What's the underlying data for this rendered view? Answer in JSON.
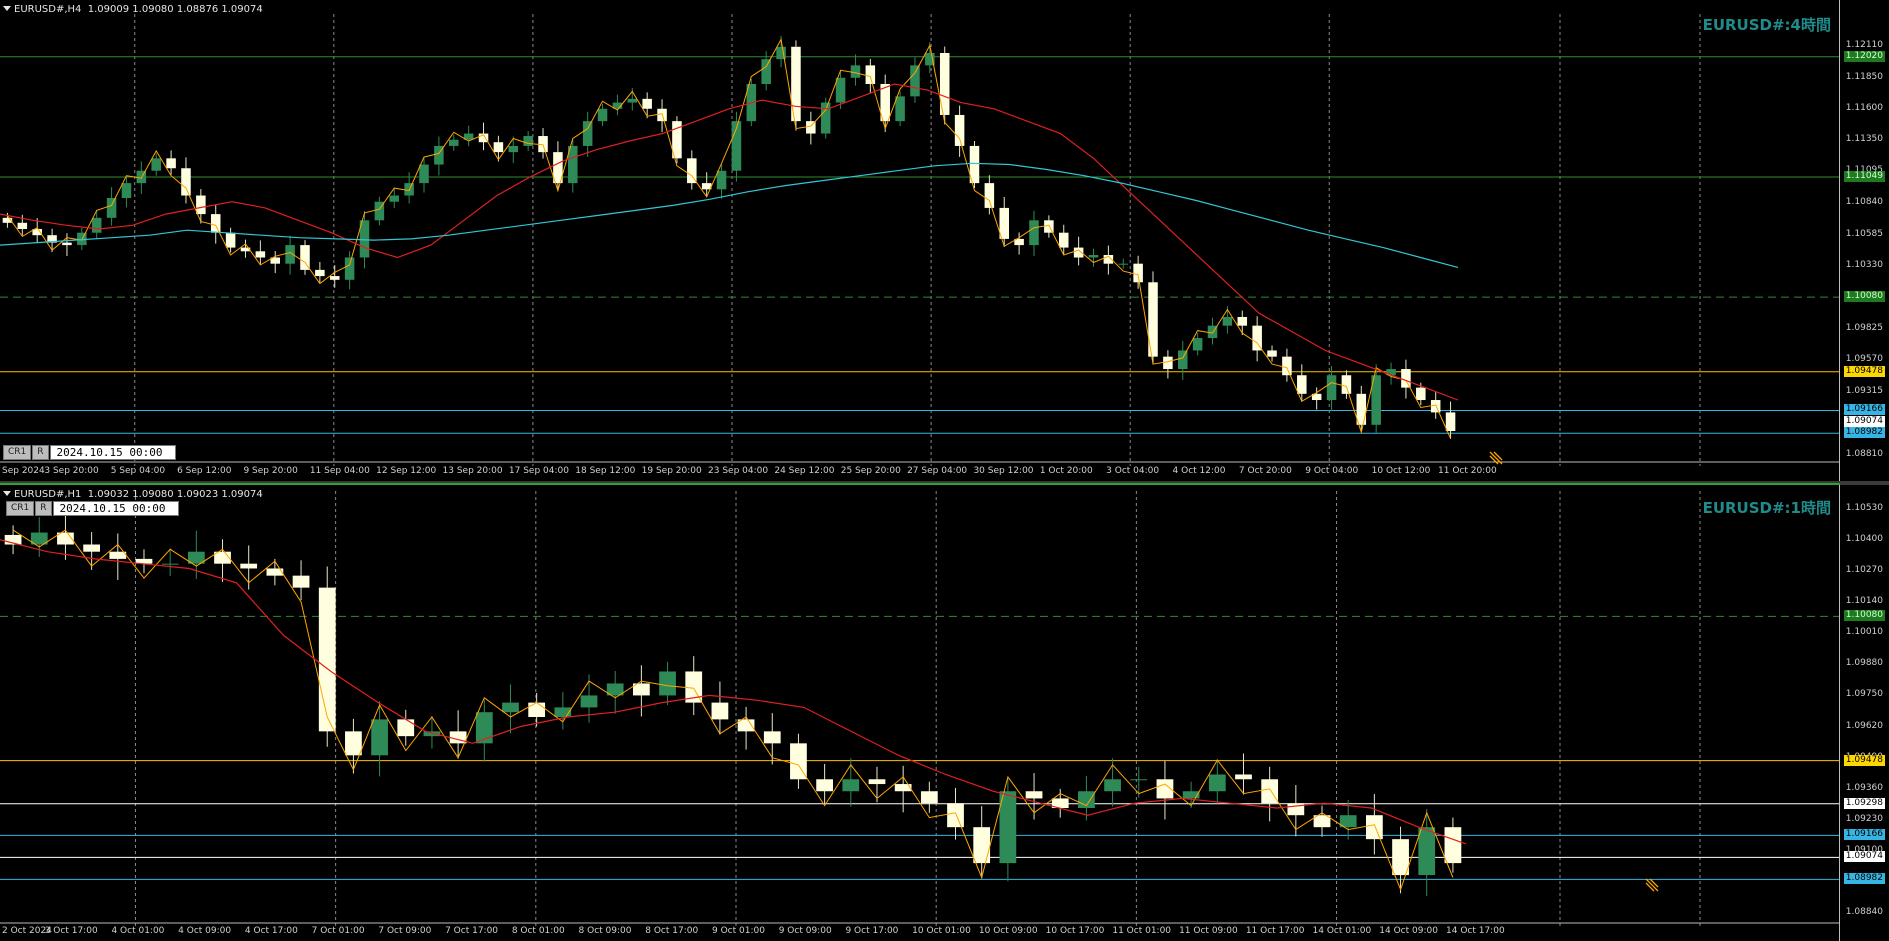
{
  "h4": {
    "header_symbol": "EURUSD#,H4",
    "header_ohlc": "1.09009 1.09080 1.08876 1.09074",
    "title": "EURUSD#:4時間",
    "cr_label": "CR1",
    "r_label": "R",
    "datetime": "2024.10.15 00:00",
    "y_min": 1.0875,
    "y_max": 1.123,
    "y_ticks": [
      "1.12110",
      "1.11850",
      "1.11600",
      "1.11350",
      "1.11095",
      "1.10840",
      "1.10585",
      "1.10330",
      "1.10080",
      "1.09825",
      "1.09570",
      "1.09315",
      "1.09074",
      "1.08810"
    ],
    "x_labels": [
      "Sep 2024",
      "3 Sep 20:00",
      "5 Sep 04:00",
      "6 Sep 12:00",
      "9 Sep 20:00",
      "11 Sep 04:00",
      "12 Sep 12:00",
      "13 Sep 20:00",
      "17 Sep 04:00",
      "18 Sep 12:00",
      "19 Sep 20:00",
      "23 Sep 04:00",
      "24 Sep 12:00",
      "25 Sep 20:00",
      "27 Sep 04:00",
      "30 Sep 12:00",
      "1 Oct 20:00",
      "3 Oct 04:00",
      "4 Oct 12:00",
      "7 Oct 20:00",
      "9 Oct 04:00",
      "10 Oct 12:00",
      "11 Oct 20:00"
    ],
    "levels": [
      {
        "price": 1.1202,
        "label": "1.12020",
        "color": "#2e8b2e",
        "tag_bg": "#1e7a1e",
        "tag_fg": "#d0ffd0",
        "dashed": false
      },
      {
        "price": 1.11049,
        "label": "1.11049",
        "color": "#2e8b2e",
        "tag_bg": "#1e7a1e",
        "tag_fg": "#d0ffd0",
        "dashed": false
      },
      {
        "price": 1.1008,
        "label": "1.10080",
        "color": "#2e8b2e",
        "tag_bg": "#1e7a1e",
        "tag_fg": "#d0ffd0",
        "dashed": true
      },
      {
        "price": 1.09478,
        "label": "1.09478",
        "color": "#ffc000",
        "tag_bg": "#ffd700",
        "tag_fg": "#000000",
        "dashed": false
      },
      {
        "price": 1.09166,
        "label": "1.09166",
        "color": "#36b5e5",
        "tag_bg": "#36b5e5",
        "tag_fg": "#000000",
        "dashed": false
      },
      {
        "price": 1.09074,
        "label": "1.09074",
        "color": "#bdbdbd",
        "tag_bg": "#ffffff",
        "tag_fg": "#000000",
        "dashed": false,
        "tag_only": true
      },
      {
        "price": 1.08982,
        "label": "1.08982",
        "color": "#36b5e5",
        "tag_bg": "#36b5e5",
        "tag_fg": "#000000",
        "dashed": false
      }
    ],
    "red_ma": [
      1.1075,
      1.107,
      1.1066,
      1.1063,
      1.1066,
      1.1075,
      1.108,
      1.1085,
      1.108,
      1.107,
      1.106,
      1.1048,
      1.104,
      1.105,
      1.107,
      1.109,
      1.1105,
      1.1118,
      1.1127,
      1.1134,
      1.114,
      1.115,
      1.116,
      1.1167,
      1.1162,
      1.116,
      1.117,
      1.118,
      1.1175,
      1.1165,
      1.116,
      1.115,
      1.114,
      1.112,
      1.1095,
      1.107,
      1.1045,
      1.102,
      1.0995,
      1.098,
      1.0965,
      1.0955,
      1.0945,
      1.0935,
      1.0925
    ],
    "cyan_ma": [
      1.105,
      1.1052,
      1.1054,
      1.1056,
      1.1058,
      1.1062,
      1.106,
      1.1058,
      1.1056,
      1.1055,
      1.1054,
      1.1055,
      1.1058,
      1.1062,
      1.1066,
      1.107,
      1.1074,
      1.1078,
      1.1082,
      1.1087,
      1.1093,
      1.1098,
      1.1102,
      1.1106,
      1.111,
      1.1114,
      1.1116,
      1.1115,
      1.1111,
      1.1106,
      1.11,
      1.1093,
      1.1086,
      1.1078,
      1.107,
      1.1062,
      1.1055,
      1.1048,
      1.104,
      1.1032
    ],
    "closes": [
      1.1068,
      1.1063,
      1.1058,
      1.1052,
      1.105,
      1.106,
      1.1072,
      1.1088,
      1.11,
      1.111,
      1.112,
      1.1112,
      1.109,
      1.1075,
      1.106,
      1.1048,
      1.1045,
      1.104,
      1.1035,
      1.105,
      1.103,
      1.1025,
      1.1022,
      1.104,
      1.107,
      1.1085,
      1.109,
      1.11,
      1.1115,
      1.113,
      1.1135,
      1.114,
      1.1133,
      1.1125,
      1.113,
      1.1138,
      1.1125,
      1.11,
      1.113,
      1.115,
      1.116,
      1.1165,
      1.1168,
      1.116,
      1.115,
      1.112,
      1.11,
      1.1095,
      1.111,
      1.115,
      1.118,
      1.12,
      1.121,
      1.115,
      1.114,
      1.1165,
      1.1185,
      1.1195,
      1.118,
      1.115,
      1.117,
      1.1195,
      1.1205,
      1.1155,
      1.113,
      1.11,
      1.108,
      1.1055,
      1.105,
      1.107,
      1.106,
      1.1048,
      1.104,
      1.1042,
      1.1035,
      1.1035,
      1.102,
      1.096,
      1.095,
      1.0965,
      1.0975,
      1.0985,
      1.0992,
      1.0985,
      1.0965,
      1.096,
      1.0945,
      1.093,
      1.0925,
      1.0945,
      1.093,
      1.0905,
      1.0945,
      1.095,
      1.0935,
      1.0925,
      1.0915,
      1.09
    ]
  },
  "h1": {
    "header_symbol": "EURUSD#,H1",
    "header_ohlc": "1.09032 1.09080 1.09023 1.09074",
    "title": "EURUSD#:1時間",
    "cr_label": "CR1",
    "r_label": "R",
    "datetime": "2024.10.15 00:00",
    "y_min": 1.088,
    "y_max": 1.1057,
    "y_ticks": [
      "1.10530",
      "1.10400",
      "1.10270",
      "1.10140",
      "1.10010",
      "1.09880",
      "1.09750",
      "1.09620",
      "1.09490",
      "1.09360",
      "1.09230",
      "1.09100",
      "1.08970",
      "1.08840"
    ],
    "x_labels": [
      "2 Oct 2024",
      "3 Oct 17:00",
      "4 Oct 01:00",
      "4 Oct 09:00",
      "4 Oct 17:00",
      "7 Oct 01:00",
      "7 Oct 09:00",
      "7 Oct 17:00",
      "8 Oct 01:00",
      "8 Oct 09:00",
      "8 Oct 17:00",
      "9 Oct 01:00",
      "9 Oct 09:00",
      "9 Oct 17:00",
      "10 Oct 01:00",
      "10 Oct 09:00",
      "10 Oct 17:00",
      "11 Oct 01:00",
      "11 Oct 09:00",
      "11 Oct 17:00",
      "14 Oct 01:00",
      "14 Oct 09:00",
      "14 Oct 17:00"
    ],
    "levels": [
      {
        "price": 1.1008,
        "label": "1.10080",
        "color": "#2e8b2e",
        "tag_bg": "#1e7a1e",
        "tag_fg": "#d0ffd0",
        "dashed": true
      },
      {
        "price": 1.09478,
        "label": "1.09478",
        "color": "#ffc000",
        "tag_bg": "#ffd700",
        "tag_fg": "#000000",
        "dashed": false
      },
      {
        "price": 1.09298,
        "label": "1.09298",
        "color": "#ffffff",
        "tag_bg": "#ffffff",
        "tag_fg": "#000000",
        "dashed": false
      },
      {
        "price": 1.09166,
        "label": "1.09166",
        "color": "#36b5e5",
        "tag_bg": "#36b5e5",
        "tag_fg": "#000000",
        "dashed": false
      },
      {
        "price": 1.09074,
        "label": "1.09074",
        "color": "#ffffff",
        "tag_bg": "#ffffff",
        "tag_fg": "#000000",
        "dashed": false
      },
      {
        "price": 1.08982,
        "label": "1.08982",
        "color": "#36b5e5",
        "tag_bg": "#36b5e5",
        "tag_fg": "#000000",
        "dashed": false
      }
    ],
    "red_ma": [
      1.104,
      1.1035,
      1.1032,
      1.103,
      1.1028,
      1.1022,
      1.1,
      1.0985,
      1.0972,
      1.096,
      1.0955,
      1.0962,
      1.0966,
      1.0968,
      1.0972,
      1.0975,
      1.0973,
      1.097,
      1.096,
      1.095,
      1.0942,
      1.0935,
      1.093,
      1.0925,
      1.093,
      1.0932,
      1.093,
      1.0928,
      1.093,
      1.0928,
      1.092,
      1.0913
    ],
    "closes": [
      1.1038,
      1.1043,
      1.1038,
      1.1035,
      1.1032,
      1.103,
      1.103,
      1.1035,
      1.103,
      1.1028,
      1.1025,
      1.102,
      1.096,
      1.095,
      1.0965,
      1.0958,
      1.096,
      1.0955,
      1.0968,
      1.0972,
      1.0966,
      1.097,
      1.0975,
      1.098,
      1.0975,
      1.0985,
      1.0972,
      1.0965,
      1.096,
      1.0955,
      1.094,
      1.0935,
      1.094,
      1.0938,
      1.0935,
      1.093,
      1.092,
      1.0905,
      1.0935,
      1.0932,
      1.0928,
      1.0935,
      1.094,
      1.094,
      1.0932,
      1.0935,
      1.0942,
      1.094,
      1.093,
      1.0925,
      1.092,
      1.0925,
      1.0915,
      1.09,
      1.092,
      1.0905
    ]
  }
}
